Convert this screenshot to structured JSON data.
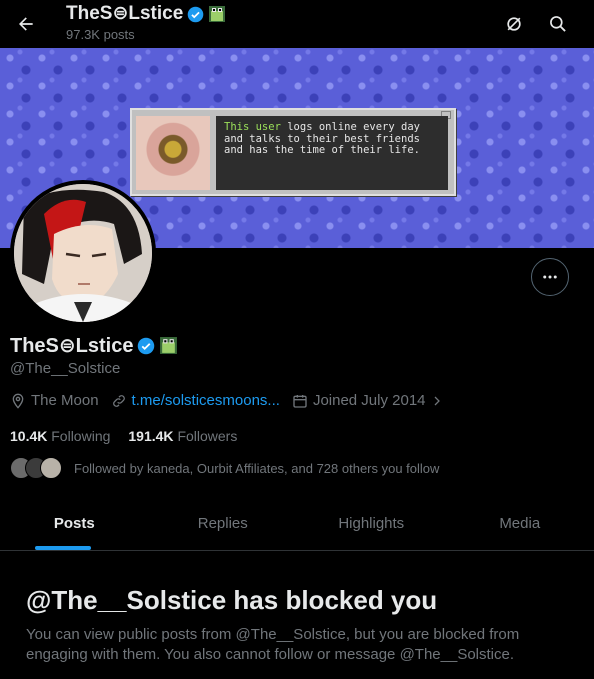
{
  "header": {
    "name": "TheS⊜Lstice",
    "post_count": "97.3K posts"
  },
  "banner": {
    "popup_text_highlight": "This user",
    "popup_text_rest": " logs online every day and talks to their best friends and has the time of their life."
  },
  "profile": {
    "name": "TheS⊜Lstice",
    "handle": "@The__Solstice",
    "location": "The Moon",
    "link": "t.me/solsticesmoons...",
    "joined": "Joined July 2014",
    "following_count": "10.4K",
    "following_label": "Following",
    "followers_count": "191.4K",
    "followers_label": "Followers",
    "followed_by": "Followed by kaneda, Ourbit Affiliates, and 728 others you follow"
  },
  "tabs": [
    "Posts",
    "Replies",
    "Highlights",
    "Media"
  ],
  "blocked": {
    "title": "@The__Solstice has blocked you",
    "description": "You can view public posts from @The__Solstice, but you are blocked from engaging with them. You also cannot follow or message @The__Solstice."
  },
  "colors": {
    "accent": "#1d9bf0",
    "background": "#000000",
    "muted_text": "#71767b"
  },
  "icons": [
    "back-arrow-icon",
    "verified-badge-icon",
    "frog-emoji-icon",
    "grok-icon",
    "search-icon",
    "more-icon",
    "location-icon",
    "link-icon",
    "calendar-icon",
    "chevron-right-icon"
  ]
}
